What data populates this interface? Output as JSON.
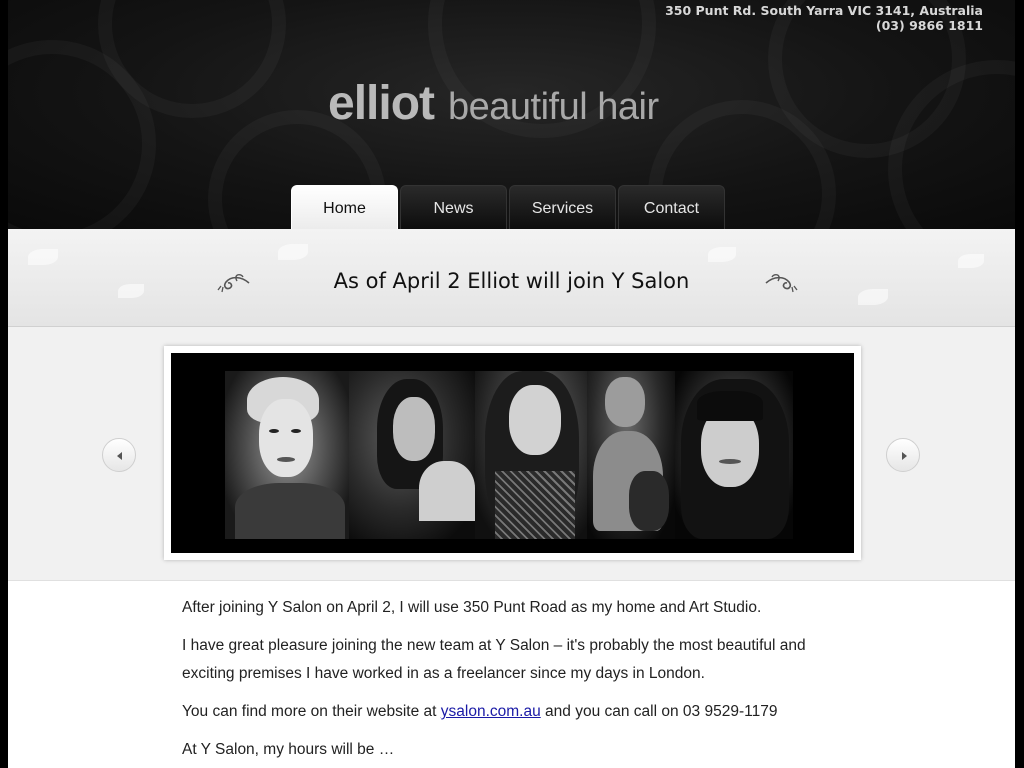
{
  "header": {
    "address_line1": "350 Punt Rd. South Yarra VIC 3141, Australia",
    "address_line2": "(03) 9866 1811",
    "logo_bold": "elliot",
    "logo_light": "beautiful hair"
  },
  "nav": {
    "tabs": [
      {
        "label": "Home",
        "active": true
      },
      {
        "label": "News",
        "active": false
      },
      {
        "label": "Services",
        "active": false
      },
      {
        "label": "Contact",
        "active": false
      }
    ]
  },
  "banner": {
    "title": "As of April 2 Elliot will join Y Salon"
  },
  "slider": {
    "prev_icon": "chevron-left-icon",
    "next_icon": "chevron-right-icon"
  },
  "content": {
    "p1": "After joining Y Salon on April 2, I will use 350 Punt Road as my home and Art Studio.",
    "p2": "I have great pleasure joining the new team at Y Salon – it's probably the most beautiful and exciting premises I have worked in as a freelancer since my days in London.",
    "p3_before": "You can find more on their website at ",
    "p3_link": "ysalon.com.au",
    "p3_after": " and you can call on 03 9529-1179",
    "p4": "At Y Salon, my hours will be …"
  }
}
